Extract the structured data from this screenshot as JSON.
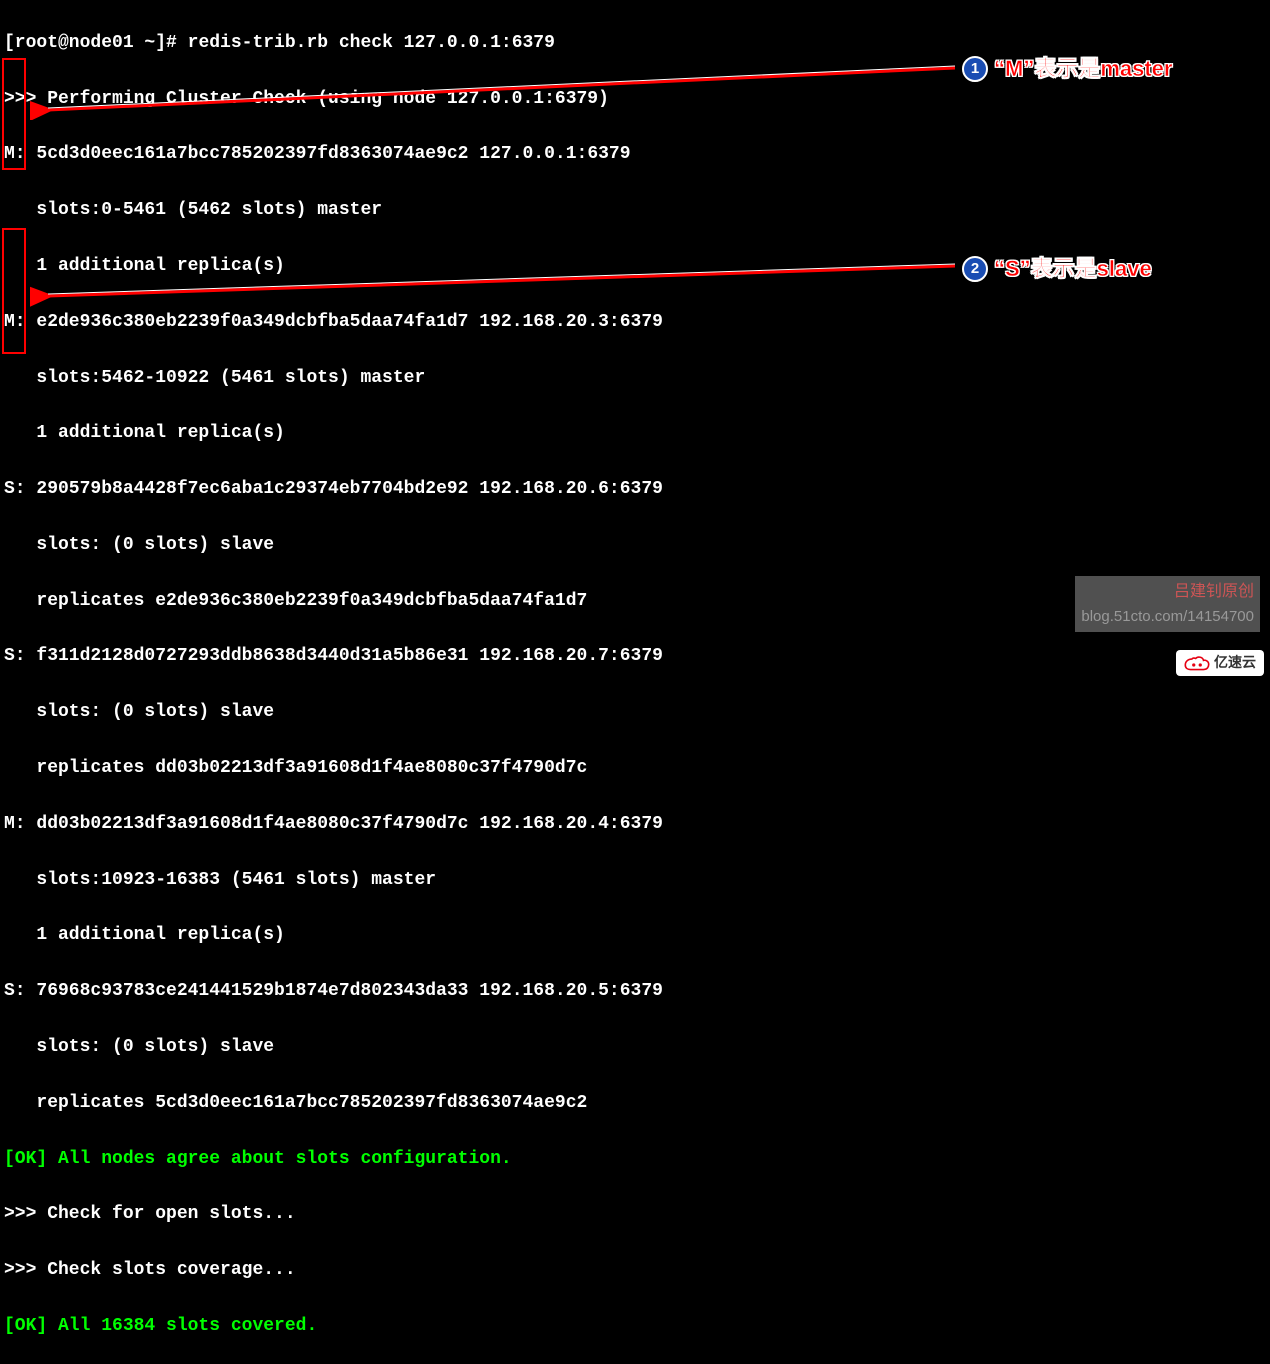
{
  "terminal": {
    "prompt": "[root@node01 ~]# ",
    "command": "redis-trib.rb check 127.0.0.1:6379",
    "header": ">>> Performing Cluster Check (using node 127.0.0.1:6379)",
    "nodes": [
      {
        "prefix": "M: ",
        "id": "5cd3d0eec161a7bcc785202397fd8363074ae9c2",
        "addr": "127.0.0.1:6379",
        "slots": "   slots:0-5461 (5462 slots) master",
        "extra": "   1 additional replica(s)"
      },
      {
        "prefix": "M: ",
        "id": "e2de936c380eb2239f0a349dcbfba5daa74fa1d7",
        "addr": "192.168.20.3:6379",
        "slots": "   slots:5462-10922 (5461 slots) master",
        "extra": "   1 additional replica(s)"
      },
      {
        "prefix": "S: ",
        "id": "290579b8a4428f7ec6aba1c29374eb7704bd2e92",
        "addr": "192.168.20.6:6379",
        "slots": "   slots: (0 slots) slave",
        "extra": "   replicates e2de936c380eb2239f0a349dcbfba5daa74fa1d7"
      },
      {
        "prefix": "S: ",
        "id": "f311d2128d0727293ddb8638d3440d31a5b86e31",
        "addr": "192.168.20.7:6379",
        "slots": "   slots: (0 slots) slave",
        "extra": "   replicates dd03b02213df3a91608d1f4ae8080c37f4790d7c"
      },
      {
        "prefix": "M: ",
        "id": "dd03b02213df3a91608d1f4ae8080c37f4790d7c",
        "addr": "192.168.20.4:6379",
        "slots": "   slots:10923-16383 (5461 slots) master",
        "extra": "   1 additional replica(s)"
      },
      {
        "prefix": "S: ",
        "id": "76968c93783ce241441529b1874e7d802343da33",
        "addr": "192.168.20.5:6379",
        "slots": "   slots: (0 slots) slave",
        "extra": "   replicates 5cd3d0eec161a7bcc785202397fd8363074ae9c2"
      }
    ],
    "ok1": "[OK] All nodes agree about slots configuration.",
    "check1": ">>> Check for open slots...",
    "check2": ">>> Check slots coverage...",
    "ok2": "[OK] All 16384 slots covered."
  },
  "annotations": {
    "anno1_num": "1",
    "anno1_text": "“M”表示是master",
    "anno2_num": "2",
    "anno2_text": "“S”表示是slave"
  },
  "watermark": {
    "line1": "吕建钊原创",
    "line2": "blog.51cto.com/14154700"
  },
  "logo": {
    "text": "亿速云"
  }
}
